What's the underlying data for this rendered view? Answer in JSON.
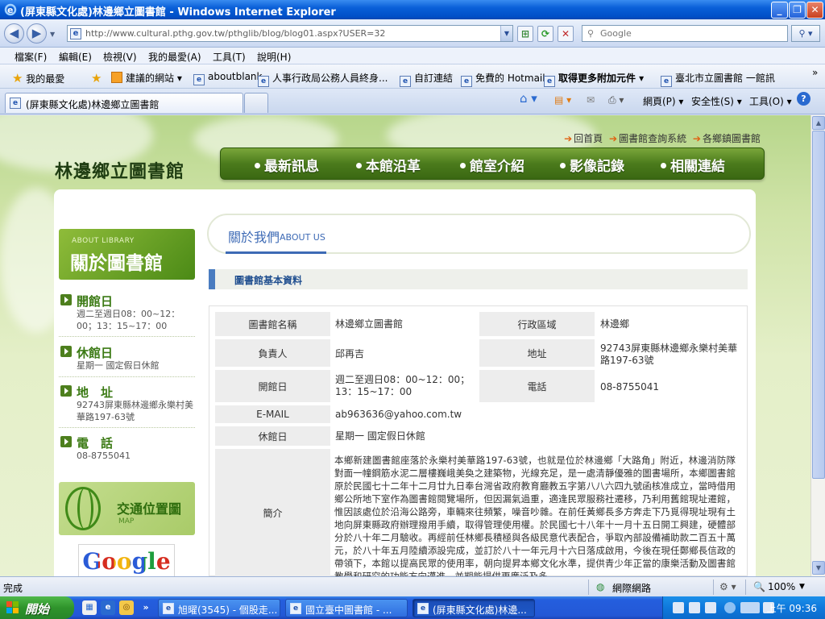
{
  "window": {
    "title": "(屏東縣文化處)林邊鄉立圖書館 - Windows Internet Explorer",
    "controls": [
      "_",
      "❐",
      "✕"
    ]
  },
  "address_bar": {
    "url": "http://www.cultural.pthg.gov.tw/pthglib/blog/blog01.aspx?USER=32",
    "search_placeholder": "Google"
  },
  "menu": [
    "檔案(F)",
    "編輯(E)",
    "檢視(V)",
    "我的最愛(A)",
    "工具(T)",
    "說明(H)"
  ],
  "favorites": {
    "label": "我的最愛",
    "items": [
      "建議的網站 ▾",
      "aboutblank",
      "人事行政局公務人員終身...",
      "自訂連結",
      "免費的 Hotmail",
      "取得更多附加元件 ▾",
      "臺北市立圖書館 一館訊"
    ],
    "overflow": "»"
  },
  "tab": {
    "active_title": "(屏東縣文化處)林邊鄉立圖書館"
  },
  "command_bar": [
    "網頁(P) ▾",
    "安全性(S) ▾",
    "工具(O) ▾"
  ],
  "site": {
    "library_name": "林邊鄉立圖書館",
    "top_links": [
      "回首頁",
      "圖書館查詢系統",
      "各鄉鎮圖書館"
    ],
    "nav": [
      "最新訊息",
      "本館沿革",
      "館室介紹",
      "影像記錄",
      "相關連結"
    ],
    "sidebar": {
      "about_en": "ABOUT LIBRARY",
      "about_zh": "關於圖書館",
      "sections": [
        {
          "heading": "開館日",
          "text": "週二至週日08：00~12：00；13：15~17：00"
        },
        {
          "heading": "休館日",
          "text": "星期一 國定假日休館"
        },
        {
          "heading": "地　址",
          "text": "92743屏東縣林邊鄉永樂村美華路197-63號"
        },
        {
          "heading": "電　話",
          "text": "08-8755041"
        }
      ],
      "map_zh": "交通位置圖",
      "map_en": "MAP",
      "google": "Google"
    },
    "about_zh": "關於我們",
    "about_en": "ABOUT US",
    "section_title": "圖書館基本資料",
    "table": {
      "name_label": "圖書館名稱",
      "name_value": "林邊鄉立圖書館",
      "district_label": "行政區域",
      "district_value": "林邊鄉",
      "head_label": "負責人",
      "head_value": "邱再吉",
      "address_label": "地址",
      "address_value": "92743屏東縣林邊鄉永樂村美華路197-63號",
      "open_label": "開館日",
      "open_value": "週二至週日08：00~12：00；13：15~17：00",
      "phone_label": "電話",
      "phone_value": "08-8755041",
      "email_label": "E-MAIL",
      "email_value": "ab963636@yahoo.com.tw",
      "closed_label": "休館日",
      "closed_value": "星期一 國定假日休館",
      "intro_label": "簡介",
      "intro_value": "本鄉新建圖書館座落於永樂村美華路197-63號，也就是位於林邊鄉「大路角」附近，林邊消防隊對面一幢鋼筋水泥二層樓巍峨美奐之建築物，光線充足，是一處清靜優雅的圖書場所，本鄉圖書館原於民國七十二年十二月廿九日奉台灣省政府教育廳教五字第八八六四九號函核准成立，當時借用鄉公所地下室作為圖書館閱覽場所，但因漏氣過重，適逢民眾服務社遷移，乃利用舊館現址遷館，惟因該處位於沿海公路旁，車輛來往頻繁，噪音吵雜。在前任黃鄉長多方奔走下乃覓得現址現有土地向屏東縣政府辦理撥用手續，取得管理使用權。於民國七十八年十一月十五日開工興建，硬體部分於八十年二月驗收。再經前任林鄉長積極與各級民意代表配合，爭取內部設備補助款二百五十萬元，於八十年五月陸續添設完成，並訂於八十一年元月十六日落成啟用，今後在現任鄭鄉長信政的帶領下，本館以提高民眾的使用率，朝向提昇本鄉文化水準，提供青少年正當的康樂活動及圖書館教學和研究的功能方向邁進。並期能提供更廣泛及多"
    }
  },
  "status": {
    "text": "完成",
    "zone": "網際網路",
    "zoom": "100%"
  },
  "taskbar": {
    "start": "開始",
    "buttons": [
      "旭曜(3545) - 個股走...",
      "國立臺中圖書館 - ...",
      "(屏東縣文化處)林邊..."
    ],
    "clock": "上午 09:36"
  }
}
